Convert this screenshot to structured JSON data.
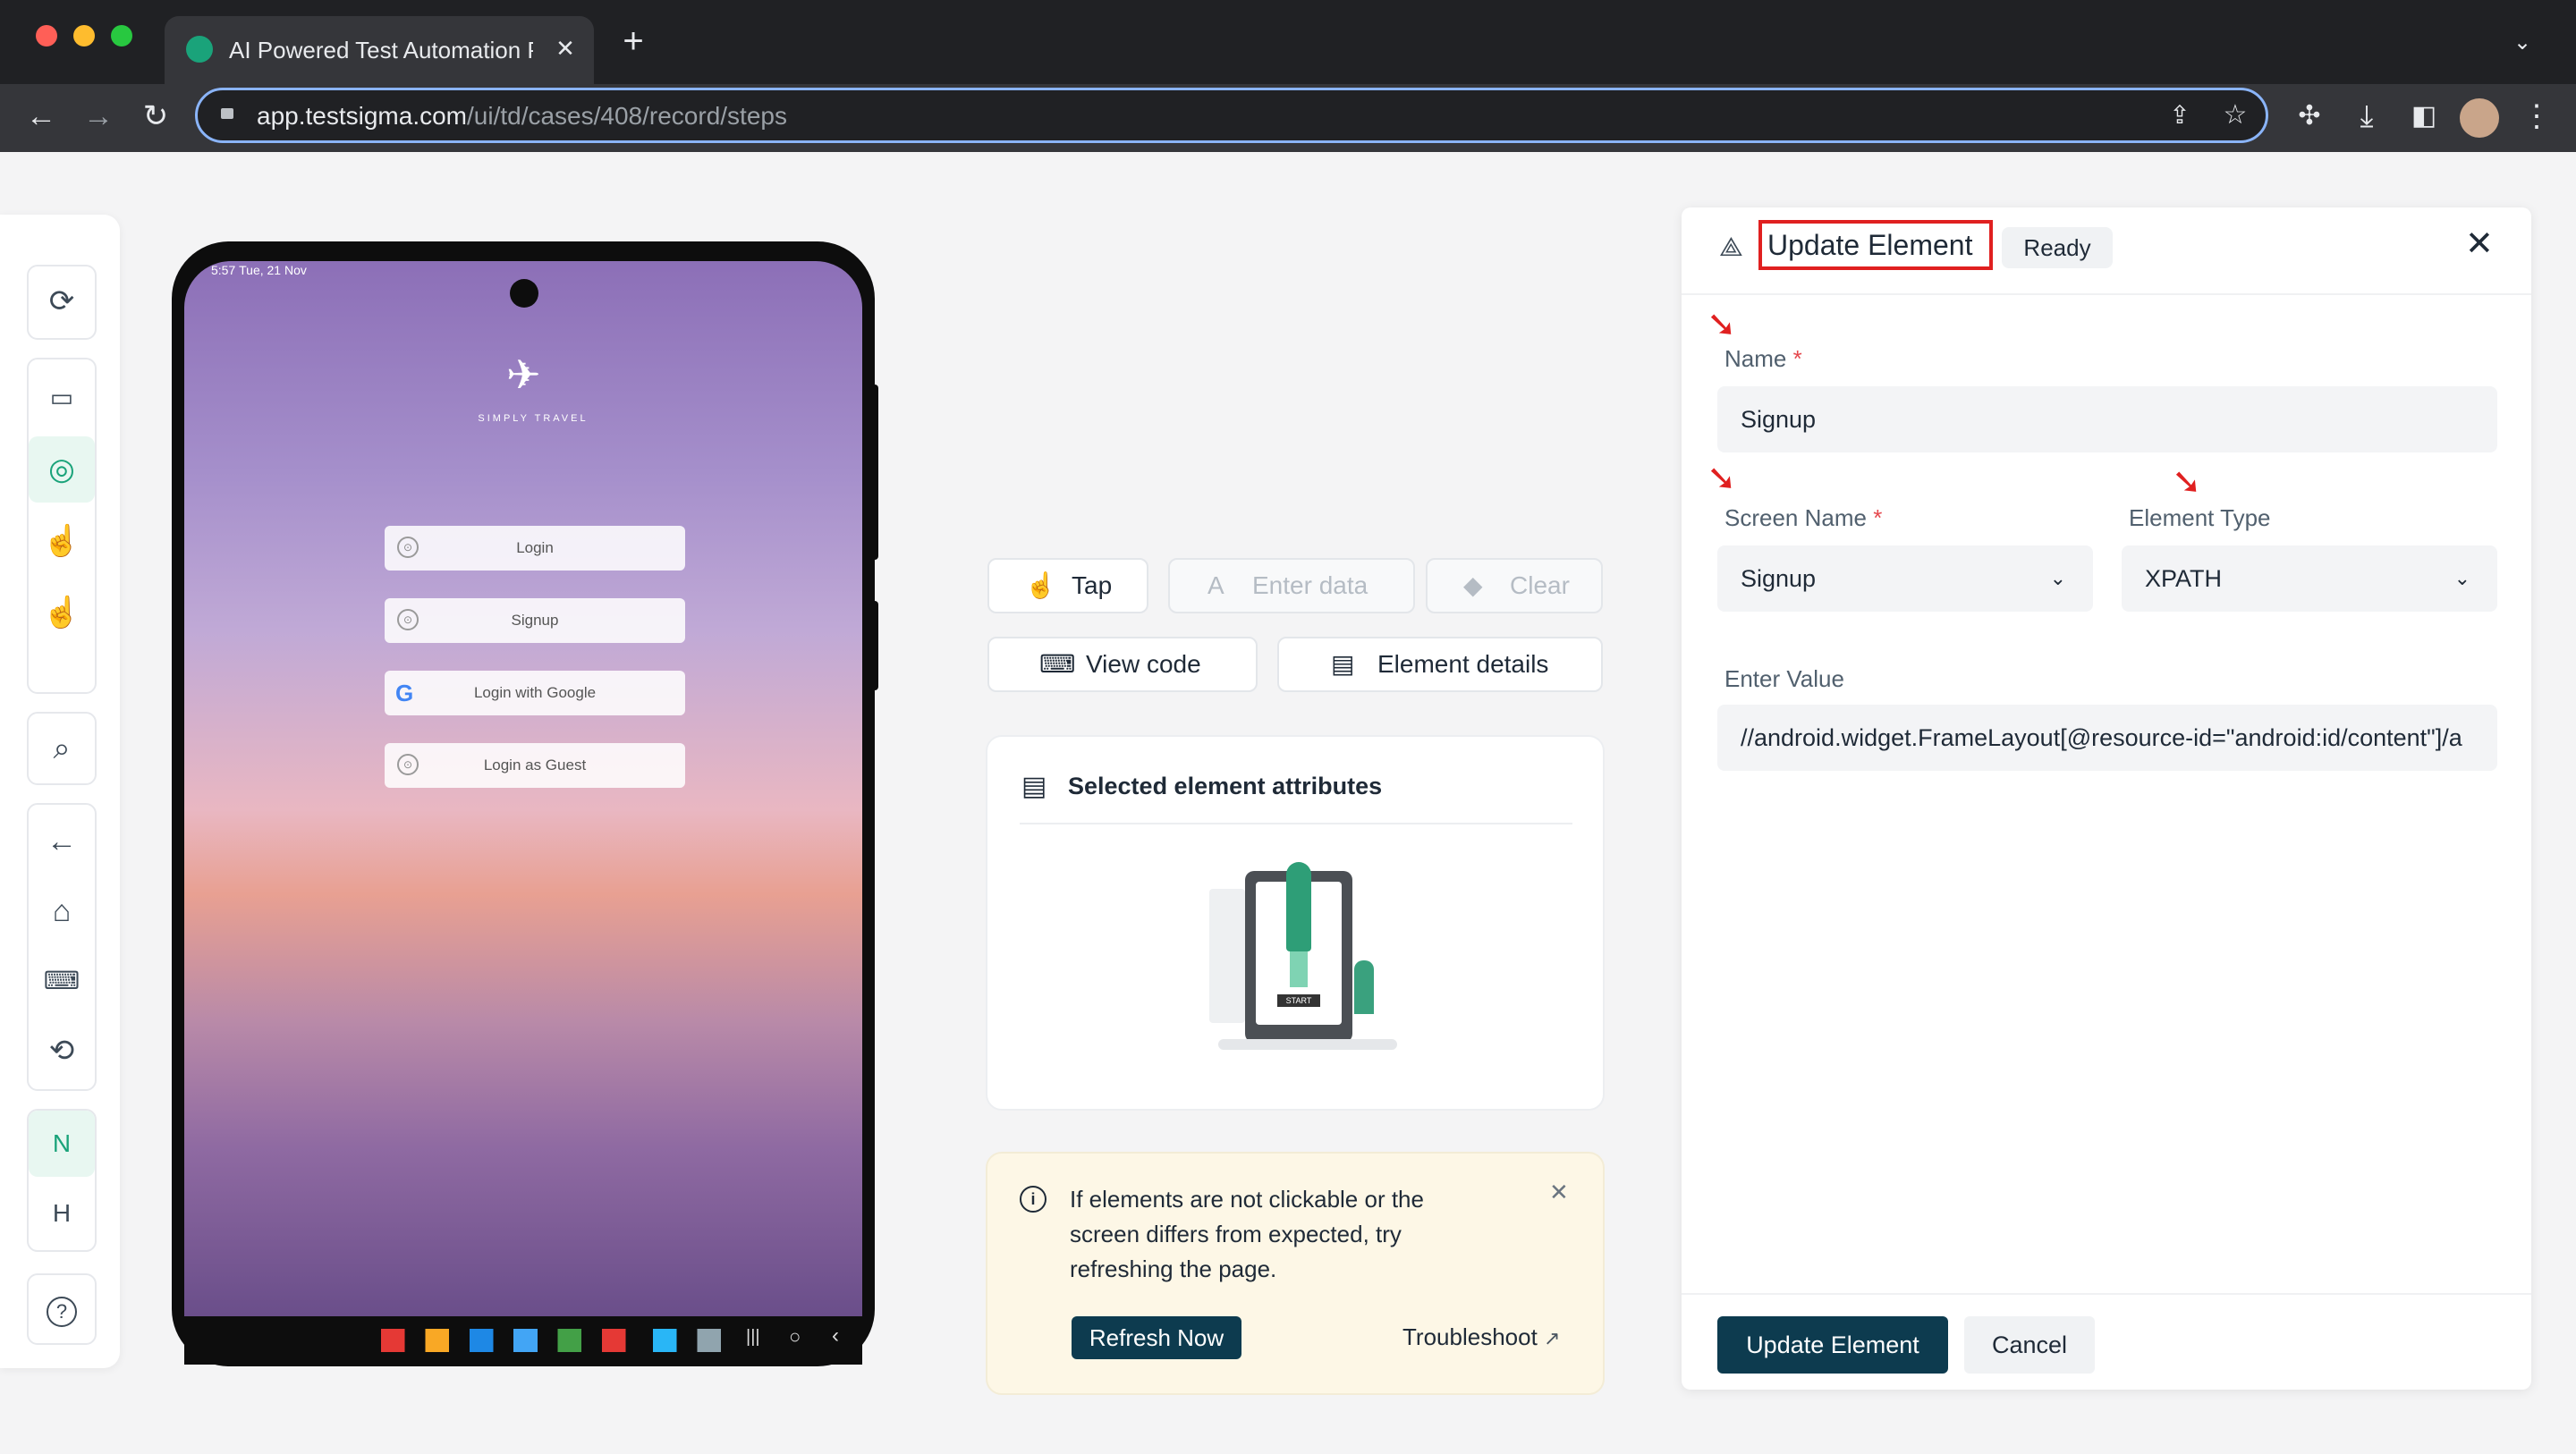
{
  "browser": {
    "tab_title": "AI Powered Test Automation P",
    "url_host": "app.testsigma.com",
    "url_path": "/ui/td/cases/408/record/steps",
    "new_tab_glyph": "+",
    "tab_close_glyph": "✕"
  },
  "sidebar": {
    "items": [
      "refresh-icon",
      "device-icon",
      "record-icon",
      "gesture-icon",
      "tap-gesture-icon",
      "search-icon",
      "back-icon",
      "home-icon",
      "keyboard-icon",
      "rotate-icon"
    ],
    "n_label": "N",
    "h_label": "H",
    "help_label": "?"
  },
  "device": {
    "status_time": "5:57",
    "status_date": "Tue, 21 Nov",
    "app_logo_text": "SIMPLY TRAVEL",
    "buttons": [
      {
        "label": "Login",
        "icon": "lock-icon"
      },
      {
        "label": "Signup",
        "icon": "lock-icon"
      },
      {
        "label": "Login with Google",
        "icon": "google-icon"
      },
      {
        "label": "Login as Guest",
        "icon": "lock-icon"
      }
    ]
  },
  "actions": {
    "tap": "Tap",
    "enter_data": "Enter data",
    "clear": "Clear",
    "view_code": "View code",
    "element_details": "Element details"
  },
  "attributes_card": {
    "title": "Selected element attributes",
    "illustration_label": "START"
  },
  "notice": {
    "text_line1": "If elements are not clickable or the",
    "text_line2": "screen differs from expected, try",
    "text_line3": "refreshing the page.",
    "refresh_button": "Refresh Now",
    "troubleshoot_link": "Troubleshoot"
  },
  "update_panel": {
    "title": "Update Element",
    "status_badge": "Ready",
    "name_label": "Name",
    "name_value": "Signup",
    "screen_name_label": "Screen Name",
    "screen_name_value": "Signup",
    "element_type_label": "Element Type",
    "element_type_value": "XPATH",
    "enter_value_label": "Enter Value",
    "enter_value_value": "//android.widget.FrameLayout[@resource-id=\"android:id/content\"]/a",
    "required_marker": "*",
    "update_button": "Update Element",
    "cancel_button": "Cancel"
  },
  "colors": {
    "primary_dark": "#0d3b4f",
    "highlight_red": "#e02020",
    "accent_green": "#1aa37a"
  }
}
